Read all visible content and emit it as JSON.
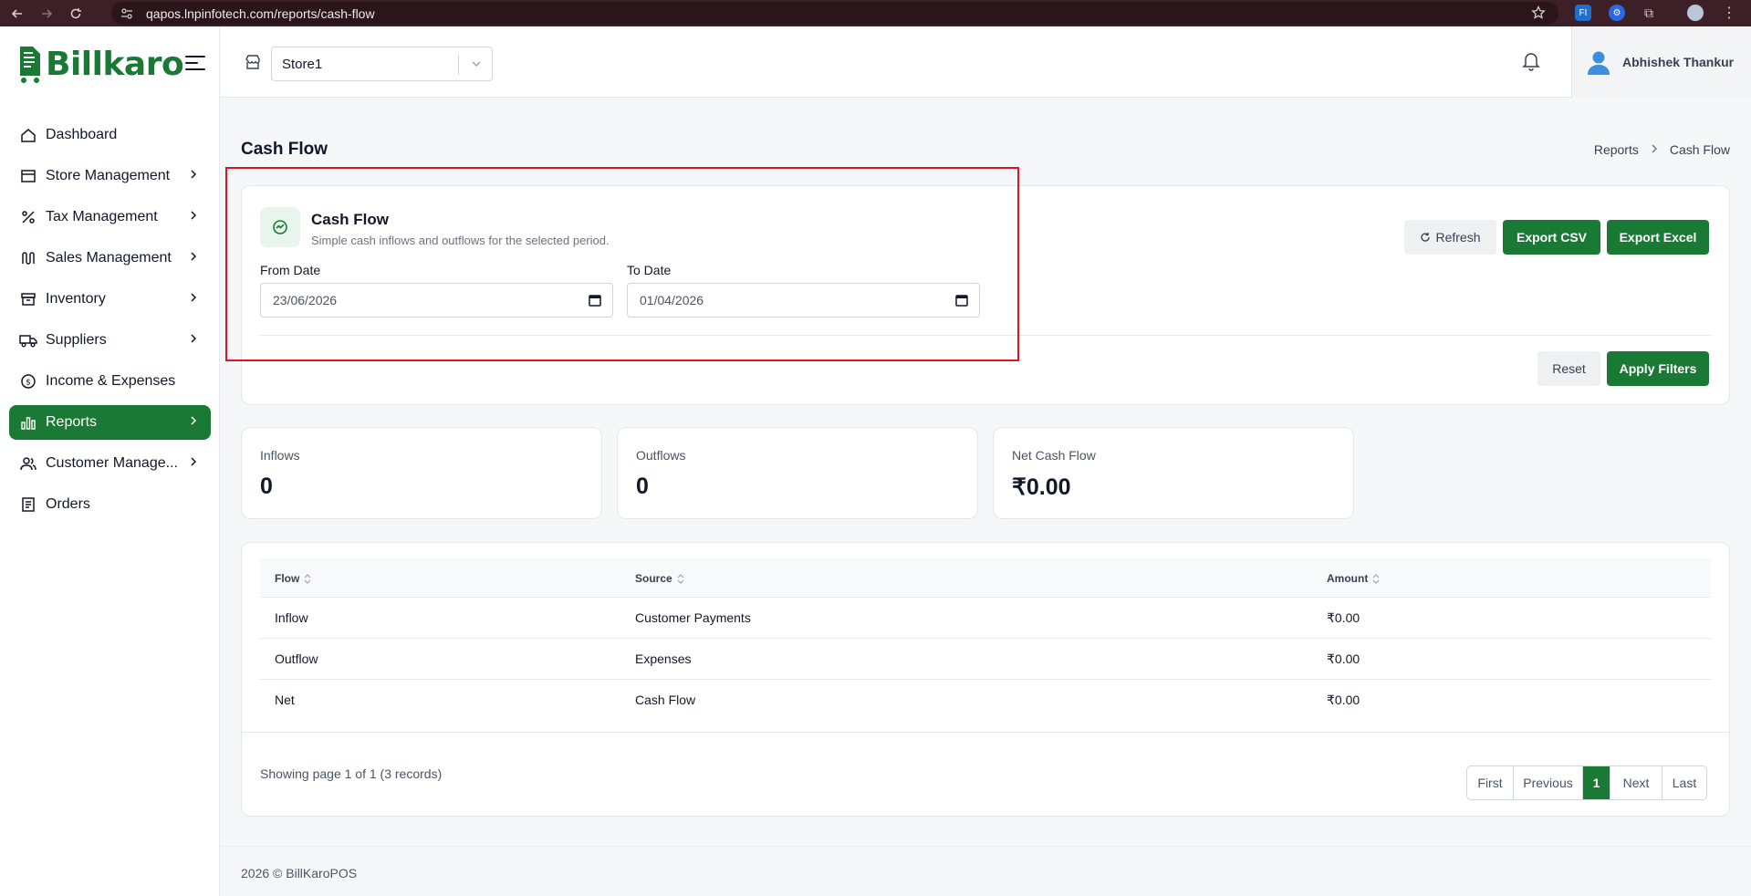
{
  "browser": {
    "url": "qapos.lnpinfotech.com/reports/cash-flow"
  },
  "sidebar": {
    "logo_text": "Billkaro",
    "items": [
      {
        "label": "Dashboard"
      },
      {
        "label": "Store Management"
      },
      {
        "label": "Tax Management"
      },
      {
        "label": "Sales Management"
      },
      {
        "label": "Inventory"
      },
      {
        "label": "Suppliers"
      },
      {
        "label": "Income & Expenses"
      },
      {
        "label": "Reports"
      },
      {
        "label": "Customer Manage..."
      },
      {
        "label": "Orders"
      }
    ]
  },
  "topbar": {
    "store_value": "Store1",
    "user_name": "Abhishek Thankur"
  },
  "page": {
    "title": "Cash Flow",
    "breadcrumb": [
      "Reports",
      "Cash Flow"
    ]
  },
  "filters": {
    "title": "Cash Flow",
    "subtitle": "Simple cash inflows and outflows for the selected period.",
    "from_label": "From Date",
    "from_value": "23/06/2026",
    "to_label": "To Date",
    "to_value": "01/04/2026",
    "refresh_label": "Refresh",
    "export_csv_label": "Export CSV",
    "export_excel_label": "Export Excel",
    "reset_label": "Reset",
    "apply_label": "Apply Filters"
  },
  "stats": [
    {
      "label": "Inflows",
      "value": "0"
    },
    {
      "label": "Outflows",
      "value": "0"
    },
    {
      "label": "Net Cash Flow",
      "value": "₹0.00"
    }
  ],
  "table": {
    "columns": [
      "Flow",
      "Source",
      "Amount"
    ],
    "rows": [
      [
        "Inflow",
        "Customer Payments",
        "₹0.00"
      ],
      [
        "Outflow",
        "Expenses",
        "₹0.00"
      ],
      [
        "Net",
        "Cash Flow",
        "₹0.00"
      ]
    ],
    "showing": "Showing page 1 of 1 (3 records)",
    "pager": [
      "First",
      "Previous",
      "1",
      "Next",
      "Last"
    ]
  },
  "footer": "2026 © BillKaroPOS",
  "colors": {
    "brand": "#1a7a35",
    "highlight": "#e0141c"
  }
}
